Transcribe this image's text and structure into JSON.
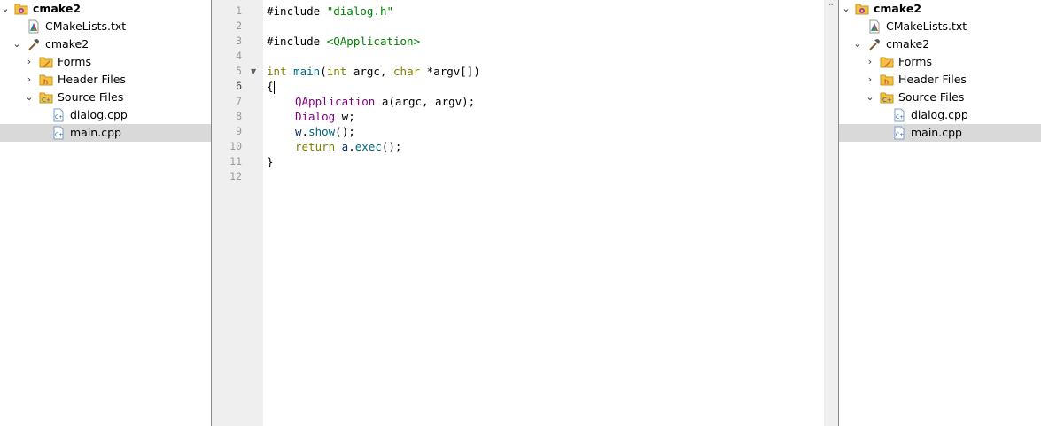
{
  "project_tree": {
    "project_name": "cmake2",
    "cmakelists": "CMakeLists.txt",
    "target_name": "cmake2",
    "folders": {
      "forms": "Forms",
      "headers": "Header Files",
      "sources": "Source Files"
    },
    "source_files": [
      "dialog.cpp",
      "main.cpp"
    ],
    "selected_file": "main.cpp"
  },
  "editor": {
    "line_numbers": [
      "1",
      "2",
      "3",
      "4",
      "5",
      "6",
      "7",
      "8",
      "9",
      "10",
      "11",
      "12"
    ],
    "current_line": "6",
    "code": {
      "l1_directive": "#include ",
      "l1_header": "\"dialog.h\"",
      "l3_directive": "#include ",
      "l3_header": "<QApplication>",
      "l5_int": "int",
      "l5_main": "main",
      "l5_open": "(",
      "l5_int2": "int",
      "l5_argc": " argc, ",
      "l5_char": "char",
      "l5_argv": " *argv[])",
      "l6_brace": "{",
      "l7_type": "QApplication",
      "l7_rest": " a(argc, argv);",
      "l8_type": "Dialog",
      "l8_rest": " w;",
      "l9_obj": "w",
      "l9_dot": ".",
      "l9_fn": "show",
      "l9_rest": "();",
      "l10_return": "return",
      "l10_obj": " a",
      "l10_dot": ".",
      "l10_fn": "exec",
      "l10_rest": "();",
      "l11_brace": "}"
    }
  },
  "icons": {
    "project": "cmake-project-icon",
    "cmakelists": "cmake-file-icon",
    "target": "hammer-icon",
    "folder": "folder-icon",
    "cpp_file": "cpp-file-icon"
  }
}
